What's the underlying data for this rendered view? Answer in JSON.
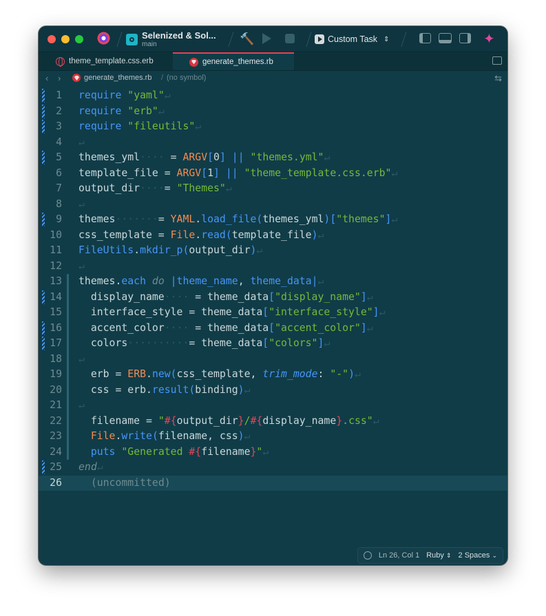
{
  "window": {
    "project_name": "Selenized & Sol...",
    "branch": "main",
    "task_label": "Custom Task"
  },
  "tabs": [
    {
      "label": "theme_template.css.erb",
      "active": false
    },
    {
      "label": "generate_themes.rb",
      "active": true
    }
  ],
  "jumpbar": {
    "file": "generate_themes.rb",
    "symbol": "(no symbol)"
  },
  "editor": {
    "current_line": 26,
    "uncommitted_label": "(uncommitted)",
    "lines": [
      "1",
      "2",
      "3",
      "4",
      "5",
      "6",
      "7",
      "8",
      "9",
      "10",
      "11",
      "12",
      "13",
      "14",
      "15",
      "16",
      "17",
      "18",
      "19",
      "20",
      "21",
      "22",
      "23",
      "24",
      "25",
      "26"
    ]
  },
  "status": {
    "position": "Ln 26, Col 1",
    "language": "Ruby",
    "indent": "2 Spaces"
  },
  "colors": {
    "background": "#103c48",
    "keyword": "#4695f7",
    "string": "#75b938",
    "constant": "#f28b50",
    "accent": "#e0475a"
  }
}
